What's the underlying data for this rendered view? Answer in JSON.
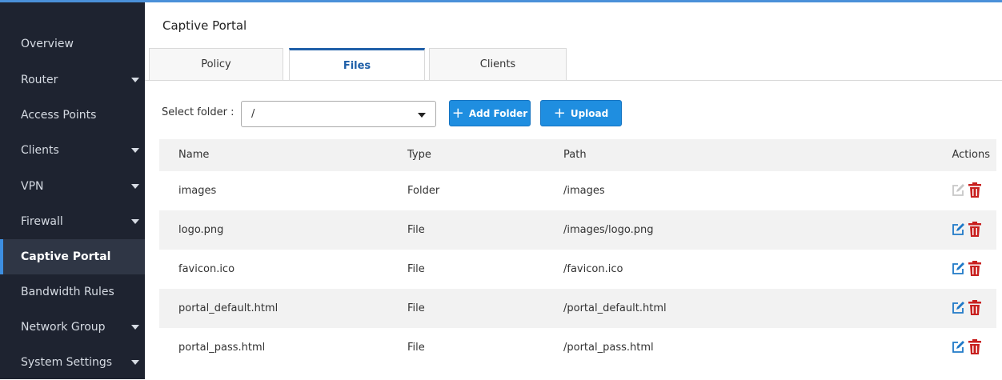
{
  "sidebar": {
    "items": [
      {
        "label": "Overview",
        "caret": false,
        "active": false
      },
      {
        "label": "Router",
        "caret": true,
        "active": false
      },
      {
        "label": "Access Points",
        "caret": false,
        "active": false
      },
      {
        "label": "Clients",
        "caret": true,
        "active": false
      },
      {
        "label": "VPN",
        "caret": true,
        "active": false
      },
      {
        "label": "Firewall",
        "caret": true,
        "active": false
      },
      {
        "label": "Captive Portal",
        "caret": false,
        "active": true
      },
      {
        "label": "Bandwidth Rules",
        "caret": false,
        "active": false
      },
      {
        "label": "Network Group",
        "caret": true,
        "active": false
      },
      {
        "label": "System Settings",
        "caret": true,
        "active": false
      }
    ]
  },
  "header": {
    "title": "Captive Portal"
  },
  "tabs": [
    {
      "label": "Policy",
      "active": false
    },
    {
      "label": "Files",
      "active": true
    },
    {
      "label": "Clients",
      "active": false
    }
  ],
  "toolbar": {
    "folder_label": "Select folder :",
    "folder_value": "/",
    "add_folder_label": "Add Folder",
    "upload_label": "Upload"
  },
  "table": {
    "columns": [
      "Name",
      "Type",
      "Path",
      "Actions"
    ],
    "rows": [
      {
        "name": "images",
        "type": "Folder",
        "path": "/images",
        "edit_enabled": false
      },
      {
        "name": "logo.png",
        "type": "File",
        "path": "/images/logo.png",
        "edit_enabled": true
      },
      {
        "name": "favicon.ico",
        "type": "File",
        "path": "/favicon.ico",
        "edit_enabled": true
      },
      {
        "name": "portal_default.html",
        "type": "File",
        "path": "/portal_default.html",
        "edit_enabled": true
      },
      {
        "name": "portal_pass.html",
        "type": "File",
        "path": "/portal_pass.html",
        "edit_enabled": true
      }
    ]
  },
  "icons": {
    "dropdown": "caret-down-icon",
    "add": "plus-icon",
    "edit": "edit-icon",
    "delete": "trash-icon"
  },
  "colors": {
    "sidebar_bg": "#1e2330",
    "accent": "#1f8ee0",
    "active_tab": "#1f5fa8",
    "delete": "#c8201f",
    "edit_disabled": "#c7c7c7"
  }
}
